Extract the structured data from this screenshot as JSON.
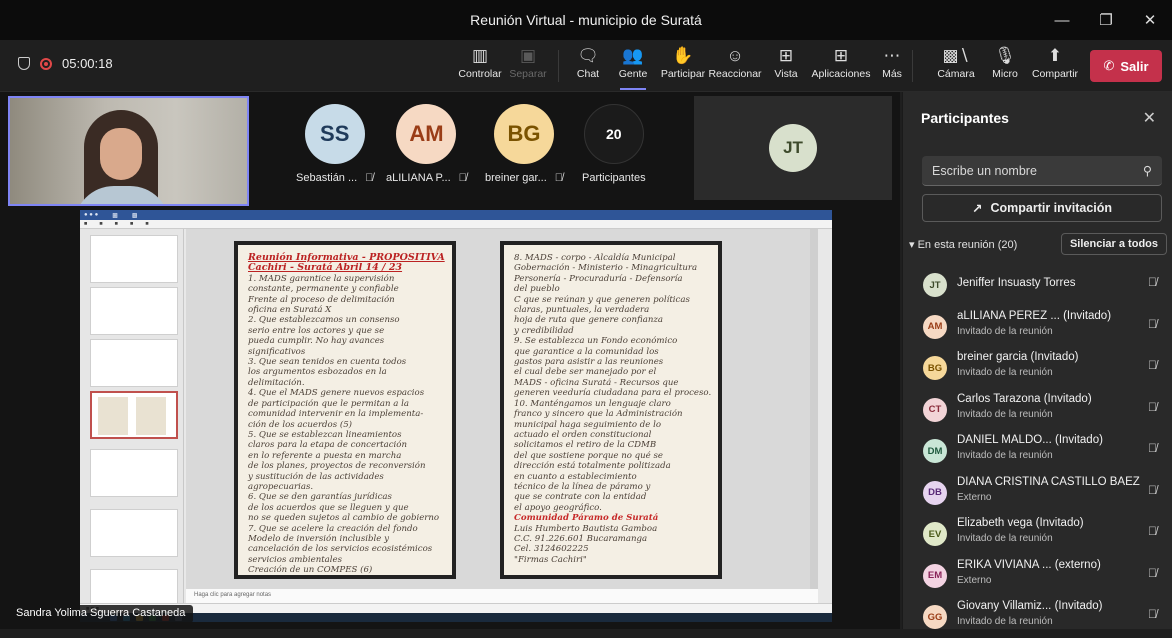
{
  "window": {
    "title": "Reunión Virtual - municipio de Suratá"
  },
  "toolbar": {
    "timer": "05:00:18",
    "buttons": {
      "control": "Controlar",
      "separate": "Separar",
      "chat": "Chat",
      "people": "Gente",
      "raise": "Participar",
      "react": "Reaccionar",
      "view": "Vista",
      "apps": "Aplicaciones",
      "more": "Más",
      "camera": "Cámara",
      "mic": "Micro",
      "share": "Compartir"
    },
    "leave": "Salir",
    "colors": {
      "leave": "#c4314b",
      "accent": "#7f85f5"
    }
  },
  "stage": {
    "tiles": [
      {
        "initials": "SS",
        "name": "Sebastián ...",
        "color": "#c7dbe8",
        "text_color": "#1f3a5a"
      },
      {
        "initials": "AM",
        "name": "aLILIANA P...",
        "color": "#f6d9c3",
        "text_color": "#9a3d17"
      },
      {
        "initials": "BG",
        "name": "breiner gar...",
        "color": "#f6d89a",
        "text_color": "#7a5200"
      }
    ],
    "overflow": {
      "count": "20",
      "label": "Participantes"
    },
    "jt_tile": {
      "initials": "JT",
      "color": "#d8e0cc",
      "text_color": "#3d4a2b"
    },
    "speaker": "Sandra Yolima Sguerra Castaneda",
    "share_notes": "Haga clic para agregar notas"
  },
  "document": {
    "left_page": [
      {
        "text": "Reunión Informativa - PROPOSITIVA",
        "style": "hd"
      },
      {
        "text": "Cachiri - Suratá Abril 14 / 23",
        "style": "hd"
      },
      {
        "text": "1. MADS garantice la supervisión"
      },
      {
        "text": "constante, permanente y confiable"
      },
      {
        "text": "Frente al proceso de delimitación"
      },
      {
        "text": "oficina en Suratá X"
      },
      {
        "text": "2. Que establezcamos un consenso"
      },
      {
        "text": "serio entre los actores y que se"
      },
      {
        "text": "pueda cumplir. No hay avances"
      },
      {
        "text": "significativos"
      },
      {
        "text": "3. Que sean tenidos en cuenta todos"
      },
      {
        "text": "los argumentos esbozados en la"
      },
      {
        "text": "delimitación."
      },
      {
        "text": "4. Que el MADS genere nuevos espacios"
      },
      {
        "text": "de participación que le permitan a la"
      },
      {
        "text": "comunidad intervenir en la implementa-"
      },
      {
        "text": "ción de los acuerdos (5)"
      },
      {
        "text": "5. Que se establezcan lineamientos"
      },
      {
        "text": "claros para la etapa de concertación"
      },
      {
        "text": "en lo referente a puesta en marcha"
      },
      {
        "text": "de los planes, proyectos de reconversión"
      },
      {
        "text": "y sustitución de las actividades"
      },
      {
        "text": "agropecuarias."
      },
      {
        "text": "6. Que se den garantías jurídicas"
      },
      {
        "text": "de los acuerdos que se lleguen y que"
      },
      {
        "text": "no se queden sujetos al cambio de gobierno"
      },
      {
        "text": "7. Que se acelere la creación del fondo"
      },
      {
        "text": "Modelo de inversión inclusible y"
      },
      {
        "text": "cancelación de los servicios ecosistémicos"
      },
      {
        "text": "servicios ambientales"
      },
      {
        "text": "Creación de un COMPES (6)"
      }
    ],
    "right_page": [
      {
        "text": "8. MADS - corpo - Alcaldía Municipal"
      },
      {
        "text": "Gobernación - Ministerio - Minagricultura"
      },
      {
        "text": "Personería - Procuraduría - Defensoría"
      },
      {
        "text": "del pueblo"
      },
      {
        "text": "C  que se reúnan y que generen políticas"
      },
      {
        "text": "claras, puntuales, la verdadera"
      },
      {
        "text": "hoja de ruta que genere confianza"
      },
      {
        "text": "y credibilidad"
      },
      {
        "text": "9. Se establezca un Fondo económico"
      },
      {
        "text": "que garantice a la comunidad los"
      },
      {
        "text": "gastos para asistir a las reuniones"
      },
      {
        "text": "el cual debe ser manejado por el"
      },
      {
        "text": "MADS - oficina Suratá - Recursos que"
      },
      {
        "text": "generen veeduría ciudadana para el proceso."
      },
      {
        "text": "10. Manténgamos un lenguaje claro"
      },
      {
        "text": "franco y sincero que la Administración"
      },
      {
        "text": "municipal haga seguimiento de lo"
      },
      {
        "text": "actuado el orden constitucional"
      },
      {
        "text": "solicitamos el retiro de la CDMB"
      },
      {
        "text": "del que sostiene porque no qué se"
      },
      {
        "text": "dirección está totalmente politizada"
      },
      {
        "text": "en cuanto a establecimiento"
      },
      {
        "text": "técnico de la línea de páramo y"
      },
      {
        "text": "que se contrate con la entidad"
      },
      {
        "text": "el apoyo geográfico."
      },
      {
        "text": "Comunidad Páramo de Suratá",
        "style": "mark"
      },
      {
        "text": "Luis Humberto Bautista Gamboa"
      },
      {
        "text": "C.C. 91.226.601 Bucaramanga"
      },
      {
        "text": "Cel. 3124602225"
      },
      {
        "text": "\"Firmas Cachiri\""
      }
    ]
  },
  "panel": {
    "title": "Participantes",
    "search_placeholder": "Escribe un nombre",
    "invite": "Compartir invitación",
    "section": "En esta reunión (20)",
    "mute_all": "Silenciar a todos",
    "participants": [
      {
        "initials": "JT",
        "name": "Jeniffer Insuasty Torres",
        "sub": "",
        "color": "#d8e0cc",
        "text_color": "#3d4a2b"
      },
      {
        "initials": "AM",
        "name": "aLILIANA PEREZ ... (Invitado)",
        "sub": "Invitado de la reunión",
        "color": "#f6d9c3",
        "text_color": "#9a3d17"
      },
      {
        "initials": "BG",
        "name": "breiner garcia (Invitado)",
        "sub": "Invitado de la reunión",
        "color": "#f6d89a",
        "text_color": "#7a5200"
      },
      {
        "initials": "CT",
        "name": "Carlos Tarazona (Invitado)",
        "sub": "Invitado de la reunión",
        "color": "#f2d4d7",
        "text_color": "#8a2c3b"
      },
      {
        "initials": "DM",
        "name": "DANIEL MALDO... (Invitado)",
        "sub": "Invitado de la reunión",
        "color": "#c9e6d6",
        "text_color": "#1f5a3e"
      },
      {
        "initials": "DB",
        "name": "DIANA CRISTINA CASTILLO BAEZ",
        "sub": "Externo",
        "color": "#e6d4ef",
        "text_color": "#5a2a78"
      },
      {
        "initials": "EV",
        "name": "Elizabeth vega (Invitado)",
        "sub": "Invitado de la reunión",
        "color": "#dfe8c8",
        "text_color": "#4a5a1a"
      },
      {
        "initials": "EM",
        "name": "ERIKA VIVIANA ... (externo)",
        "sub": "Externo",
        "color": "#f3d3e2",
        "text_color": "#8a2359"
      },
      {
        "initials": "GG",
        "name": "Giovany Villamiz... (Invitado)",
        "sub": "Invitado de la reunión",
        "color": "#f6d9c3",
        "text_color": "#9a3d17"
      }
    ]
  }
}
